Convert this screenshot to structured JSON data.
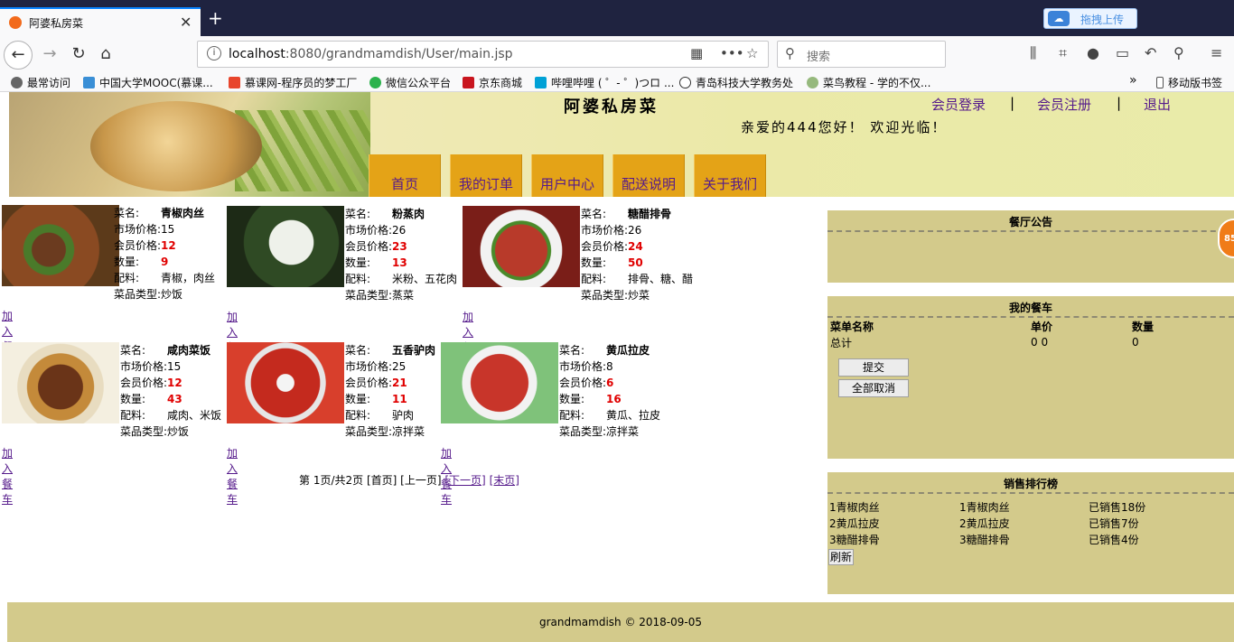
{
  "browser": {
    "tab_title": "阿婆私房菜",
    "tab_close": "✕",
    "new_tab": "+",
    "upload_label": "拖拽上传",
    "url_host": "localhost",
    "url_rest": ":8080/grandmamdish/User/main.jsp",
    "search_placeholder": "搜索",
    "bookmarks": [
      "最常访问",
      "中国大学MOOC(慕课...",
      "慕课网-程序员的梦工厂",
      "微信公众平台",
      "京东商城",
      "哔哩哔哩 ( ゜- ゜)つロ ...",
      "青岛科技大学教务处",
      "菜鸟教程 - 学的不仅...",
      "移动版书签"
    ]
  },
  "header": {
    "site_name": "阿婆私房菜",
    "welcome": "亲爱的444您好！ 欢迎光临！",
    "links": [
      "会员登录",
      "会员注册",
      "退出"
    ],
    "separator": "|",
    "menu": [
      "首页",
      "我的订单",
      "用户中心",
      "配送说明",
      "关于我们"
    ]
  },
  "labels": {
    "name": "菜名:",
    "market": "市场价格:",
    "member": "会员价格:",
    "qty": "数量:",
    "ingredients": "配料:",
    "type": "菜品类型:",
    "add_cart": "加入餐车"
  },
  "dishes": [
    {
      "name": "青椒肉丝",
      "market": "15",
      "member": "12",
      "qty": "9",
      "ingredients": "青椒，肉丝",
      "type": "炒饭"
    },
    {
      "name": "粉蒸肉",
      "market": "26",
      "member": "23",
      "qty": "13",
      "ingredients": "米粉、五花肉",
      "type": "蒸菜"
    },
    {
      "name": "糖醋排骨",
      "market": "26",
      "member": "24",
      "qty": "50",
      "ingredients": "排骨、糖、醋",
      "type": "炒菜"
    },
    {
      "name": "咸肉菜饭",
      "market": "15",
      "member": "12",
      "qty": "43",
      "ingredients": "咸肉、米饭",
      "type": "炒饭"
    },
    {
      "name": "五香驴肉",
      "market": "25",
      "member": "21",
      "qty": "11",
      "ingredients": "驴肉",
      "type": "凉拌菜"
    },
    {
      "name": "黄瓜拉皮",
      "market": "8",
      "member": "6",
      "qty": "16",
      "ingredients": "黄瓜、拉皮",
      "type": "凉拌菜"
    }
  ],
  "pager": {
    "info": "第 1页/共2页",
    "first": "[首页]",
    "prev": "[上一页]",
    "next": "[下一页]",
    "last": "[末页]"
  },
  "notice": {
    "title": "餐厅公告"
  },
  "cart": {
    "title": "我的餐车",
    "col_name": "菜单名称",
    "col_price": "单价",
    "col_qty": "数量",
    "total_label": "总计",
    "total_price": "0 0",
    "total_qty": "0",
    "submit": "提交",
    "cancel_all": "全部取消"
  },
  "rank": {
    "title": "销售排行榜",
    "rows": [
      {
        "a": "1青椒肉丝",
        "b": "1青椒肉丝",
        "c": "已销售18份"
      },
      {
        "a": "2黄瓜拉皮",
        "b": "2黄瓜拉皮",
        "c": "已销售7份"
      },
      {
        "a": "3糖醋排骨",
        "b": "3糖醋排骨",
        "c": "已销售4份"
      }
    ],
    "refresh": "刷新"
  },
  "footer": "grandmamdish    ©    2018-09-05",
  "float_badge": "85"
}
